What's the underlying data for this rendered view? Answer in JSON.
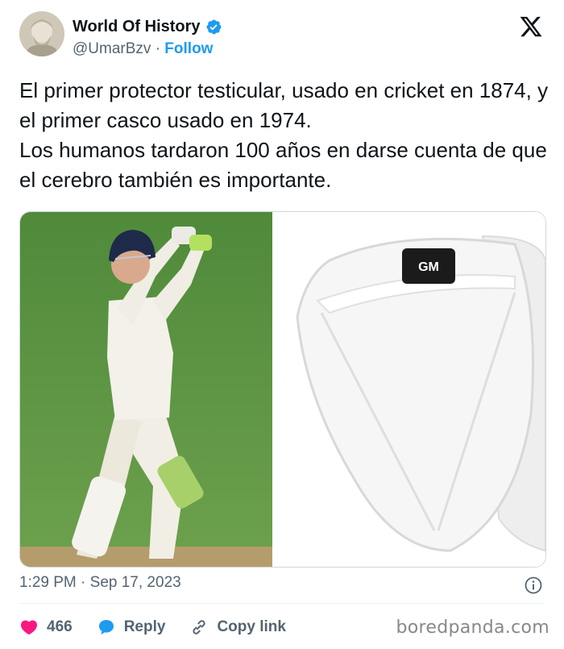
{
  "post": {
    "author_name": "World Of History",
    "handle": "@UmarBzv",
    "separator": "·",
    "follow_label": "Follow",
    "text": "El primer protector testicular, usado en cricket en 1874, y el primer casco usado en 1974.\nLos humanos tardaron 100 años en darse cuenta de que el cerebro también es importante.",
    "time": "1:29 PM",
    "date": "Sep 17, 2023",
    "likes": "466",
    "reply_label": "Reply",
    "copy_link_label": "Copy link",
    "media_brand_text": "GM"
  },
  "watermark": "boredpanda.com",
  "colors": {
    "accent": "#1d9bf0",
    "like": "#f91880",
    "muted": "#536471"
  },
  "icons": {
    "verified": "verified-badge-icon",
    "x_logo": "x-logo-icon",
    "info": "info-icon",
    "like": "heart-icon",
    "reply": "speech-bubble-icon",
    "copy_link": "link-icon"
  }
}
